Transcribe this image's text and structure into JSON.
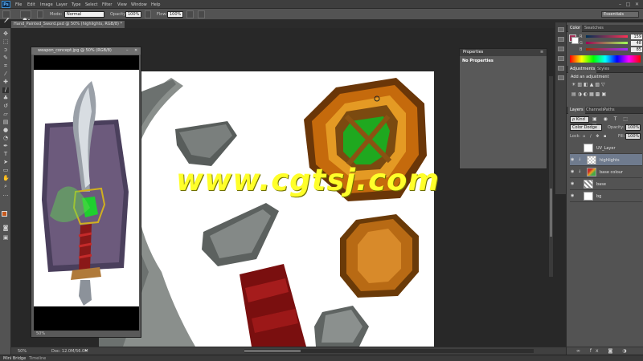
{
  "app": {
    "logo": "Ps"
  },
  "menu": [
    "File",
    "Edit",
    "Image",
    "Layer",
    "Type",
    "Select",
    "Filter",
    "View",
    "Window",
    "Help"
  ],
  "window_controls": {
    "minimize": "–",
    "maximize": "□",
    "close": "✕"
  },
  "options_bar": {
    "mode_label": "Mode:",
    "mode_value": "Normal",
    "opacity_label": "Opacity:",
    "opacity_value": "100%",
    "flow_label": "Flow:",
    "flow_value": "100%"
  },
  "workspace": "Essentials",
  "document_tab": "Hand_Painted_Sword.psd @ 50% (highlights, RGB/8) *",
  "float_window": {
    "title": "weapon_concept.jpg @ 50% (RGB/8)",
    "zoom": "50%"
  },
  "status": {
    "zoom": "50%",
    "doc": "Doc: 12.0M/56.0M"
  },
  "bottom_tabs": [
    "Mini Bridge",
    "Timeline"
  ],
  "watermark": "www.cgtsj.com",
  "properties": {
    "tab": "Properties",
    "empty_text": "No Properties"
  },
  "color_panel": {
    "tabs": [
      "Color",
      "Swatches"
    ],
    "channels": [
      {
        "label": "R",
        "value": "159"
      },
      {
        "label": "G",
        "value": "48"
      },
      {
        "label": "B",
        "value": "85"
      }
    ],
    "foreground": "#9f3055"
  },
  "adjustments_panel": {
    "tabs": [
      "Adjustments",
      "Styles"
    ],
    "add_label": "Add an adjustment"
  },
  "layers_panel": {
    "tabs": [
      "Layers",
      "Channels",
      "Paths"
    ],
    "filter_kind": "ρ Kind",
    "blend_mode": "Color Dodge",
    "opacity_label": "Opacity:",
    "opacity_value": "100%",
    "lock_label": "Lock:",
    "fill_label": "Fill:",
    "fill_value": "100%",
    "layers": [
      {
        "name": "UV_Layer",
        "visible": false,
        "selected": false
      },
      {
        "name": "highlights",
        "visible": true,
        "selected": true
      },
      {
        "name": "base colour",
        "visible": true,
        "selected": false
      },
      {
        "name": "base",
        "visible": true,
        "selected": false
      },
      {
        "name": "bg",
        "visible": true,
        "selected": false
      }
    ]
  },
  "colors": {
    "accent_blue": "#3b8ed0",
    "watermark": "#ffff2a",
    "selected_layer": "#6f7b8e"
  }
}
